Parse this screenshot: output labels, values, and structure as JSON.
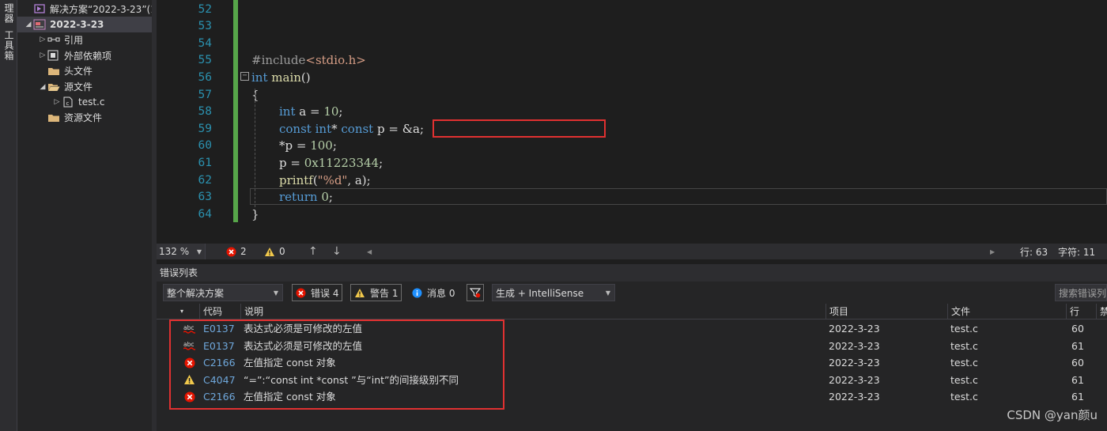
{
  "left_strip": {
    "tabs": [
      "理器",
      "工具箱"
    ]
  },
  "solution_explorer": {
    "items": [
      {
        "label": "解决方案“2022-3-23”(1",
        "icon": "solution-icon",
        "arrow": "",
        "indent": 0,
        "bold": false
      },
      {
        "label": "2022-3-23",
        "icon": "project-icon",
        "arrow": "◢",
        "indent": 0,
        "bold": true
      },
      {
        "label": "引用",
        "icon": "references-icon",
        "arrow": "▷",
        "indent": 1,
        "bold": false
      },
      {
        "label": "外部依赖项",
        "icon": "dependencies-icon",
        "arrow": "▷",
        "indent": 1,
        "bold": false
      },
      {
        "label": "头文件",
        "icon": "folder-icon",
        "arrow": "",
        "indent": 1,
        "bold": false
      },
      {
        "label": "源文件",
        "icon": "folder-open-icon",
        "arrow": "◢",
        "indent": 1,
        "bold": false
      },
      {
        "label": "test.c",
        "icon": "c-file-icon",
        "arrow": "▷",
        "indent": 2,
        "bold": false
      },
      {
        "label": "资源文件",
        "icon": "folder-icon",
        "arrow": "",
        "indent": 1,
        "bold": false
      }
    ]
  },
  "editor": {
    "line_numbers": [
      "52",
      "53",
      "54",
      "55",
      "56",
      "57",
      "58",
      "59",
      "60",
      "61",
      "62",
      "63",
      "64"
    ],
    "code_lines": [
      {
        "line": "55",
        "indent": 0,
        "tokens": [
          {
            "t": "#include",
            "c": "pp"
          },
          {
            "t": "<stdio.h>",
            "c": "str"
          }
        ]
      },
      {
        "line": "56",
        "indent": 0,
        "tokens": [
          {
            "t": "int",
            "c": "kw"
          },
          {
            "t": " ",
            "c": ""
          },
          {
            "t": "main",
            "c": "fn"
          },
          {
            "t": "()",
            "c": ""
          }
        ]
      },
      {
        "line": "57",
        "indent": 0,
        "tokens": [
          {
            "t": "{",
            "c": ""
          }
        ]
      },
      {
        "line": "58",
        "indent": 1,
        "tokens": [
          {
            "t": "int",
            "c": "kw"
          },
          {
            "t": " a = ",
            "c": ""
          },
          {
            "t": "10",
            "c": "num"
          },
          {
            "t": ";",
            "c": ""
          }
        ]
      },
      {
        "line": "59",
        "indent": 1,
        "tokens": [
          {
            "t": "const",
            "c": "kw"
          },
          {
            "t": " ",
            "c": ""
          },
          {
            "t": "int",
            "c": "kw"
          },
          {
            "t": "* ",
            "c": ""
          },
          {
            "t": "const",
            "c": "kw"
          },
          {
            "t": " p = &a;",
            "c": ""
          }
        ]
      },
      {
        "line": "60",
        "indent": 1,
        "tokens": [
          {
            "t": "*p = ",
            "c": ""
          },
          {
            "t": "100",
            "c": "num"
          },
          {
            "t": ";",
            "c": ""
          }
        ]
      },
      {
        "line": "61",
        "indent": 1,
        "tokens": [
          {
            "t": "p = ",
            "c": ""
          },
          {
            "t": "0x11223344",
            "c": "num"
          },
          {
            "t": ";",
            "c": ""
          }
        ]
      },
      {
        "line": "62",
        "indent": 1,
        "tokens": [
          {
            "t": "printf",
            "c": "fn"
          },
          {
            "t": "(",
            "c": ""
          },
          {
            "t": "\"%d\"",
            "c": "str"
          },
          {
            "t": ", a);",
            "c": ""
          }
        ]
      },
      {
        "line": "63",
        "indent": 1,
        "tokens": [
          {
            "t": "return",
            "c": "kw"
          },
          {
            "t": " ",
            "c": ""
          },
          {
            "t": "0",
            "c": "num"
          },
          {
            "t": ";",
            "c": ""
          }
        ]
      },
      {
        "line": "64",
        "indent": 0,
        "tokens": [
          {
            "t": "}",
            "c": ""
          }
        ]
      }
    ]
  },
  "editor_status": {
    "zoom": "132 %",
    "errors": "2",
    "warnings": "0",
    "line": "行: 63",
    "column": "字符: 11"
  },
  "error_list": {
    "title": "错误列表",
    "scope": "整个解决方案",
    "errors_btn": "错误 4",
    "warnings_btn": "警告 1",
    "messages_btn": "消息 0",
    "source": "生成 + IntelliSense",
    "search_placeholder": "搜索错误列",
    "columns": {
      "code": "代码",
      "desc": "说明",
      "project": "项目",
      "file": "文件",
      "line": "行",
      "suppress": "禁"
    },
    "rows": [
      {
        "icon": "intellisense-error-icon",
        "code": "E0137",
        "desc": "表达式必须是可修改的左值",
        "project": "2022-3-23",
        "file": "test.c",
        "line": "60"
      },
      {
        "icon": "intellisense-error-icon",
        "code": "E0137",
        "desc": "表达式必须是可修改的左值",
        "project": "2022-3-23",
        "file": "test.c",
        "line": "61"
      },
      {
        "icon": "error-icon",
        "code": "C2166",
        "desc": "左值指定 const 对象",
        "project": "2022-3-23",
        "file": "test.c",
        "line": "60"
      },
      {
        "icon": "warning-icon",
        "code": "C4047",
        "desc": "“=”:“const int *const ”与“int”的间接级别不同",
        "project": "2022-3-23",
        "file": "test.c",
        "line": "61"
      },
      {
        "icon": "error-icon",
        "code": "C2166",
        "desc": "左值指定 const 对象",
        "project": "2022-3-23",
        "file": "test.c",
        "line": "61"
      }
    ]
  },
  "watermark": "CSDN @yan颜u",
  "colors": {
    "highlight_box": "#e03131",
    "keyword": "#569cd6",
    "line_number": "#2b91af",
    "error": "#e51400",
    "warning": "#f2c94c"
  }
}
